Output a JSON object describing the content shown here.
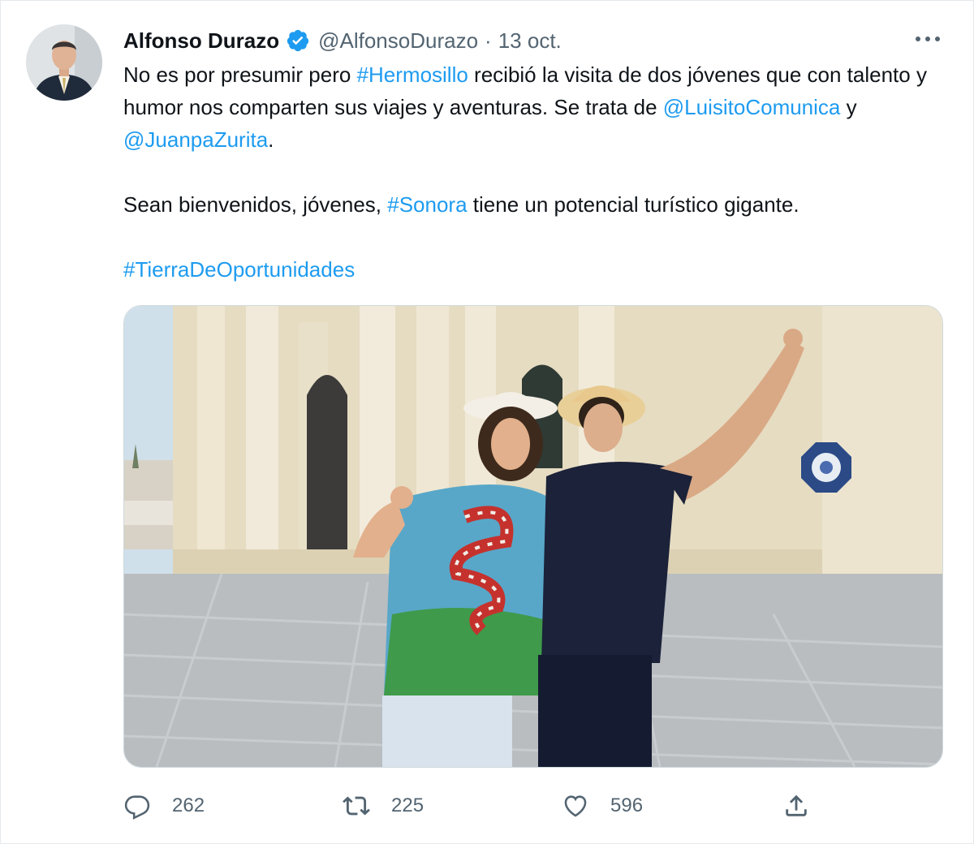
{
  "tweet": {
    "author_name": "Alfonso Durazo",
    "author_handle": "@AlfonsoDurazo",
    "separator": "·",
    "date": "13 oct.",
    "text": {
      "p1_a": "No es por presumir pero ",
      "p1_tag": "#Hermosillo",
      "p1_b": " recibió la visita de dos jóvenes que con talento y humor nos comparten sus viajes y aventuras. Se trata de ",
      "p1_mention1": "@LuisitoComunica",
      "p1_c": " y ",
      "p1_mention2": "@JuanpaZurita",
      "p1_d": ".",
      "p2_a": "Sean bienvenidos, jóvenes, ",
      "p2_tag": "#Sonora",
      "p2_b": " tiene un potencial turístico gigante.",
      "p3_tag": "#TierraDeOportunidades"
    }
  },
  "actions": {
    "reply_count": "262",
    "retweet_count": "225",
    "like_count": "596"
  },
  "icons": {
    "verified": "verified-badge-icon",
    "more": "more-options-icon",
    "reply": "reply-icon",
    "retweet": "retweet-icon",
    "like": "like-icon",
    "share": "share-icon"
  },
  "colors": {
    "accent": "#1d9bf0",
    "secondary_text": "#536471",
    "primary_text": "#0f1419"
  }
}
